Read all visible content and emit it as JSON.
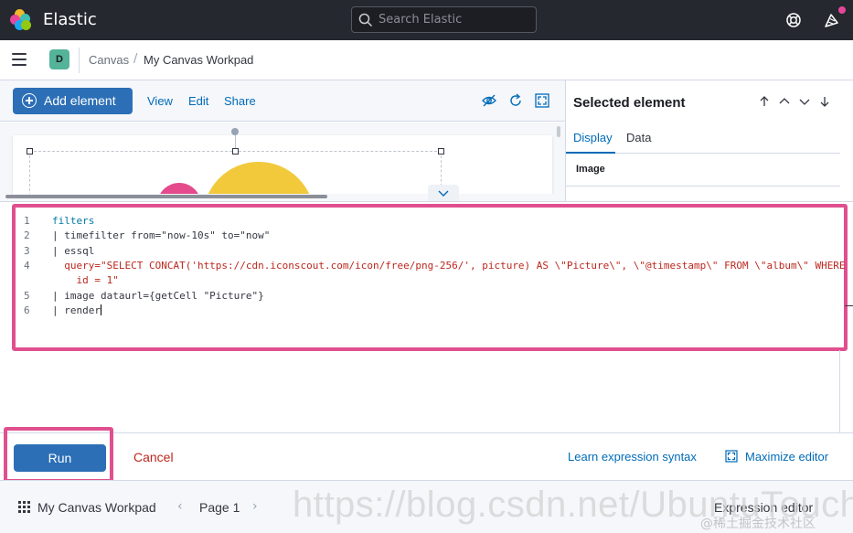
{
  "header": {
    "brand": "Elastic",
    "search_placeholder": "Search Elastic"
  },
  "breadcrumbs": {
    "space_initial": "D",
    "items": [
      "Canvas",
      "My Canvas Workpad"
    ],
    "separator": "/"
  },
  "toolbar": {
    "add_element": "Add element",
    "view": "View",
    "edit": "Edit",
    "share": "Share"
  },
  "right_panel": {
    "title": "Selected element",
    "tabs": [
      "Display",
      "Data"
    ],
    "section": "Image"
  },
  "editor": {
    "lines": [
      {
        "num": "1",
        "text": "filters"
      },
      {
        "num": "2",
        "text": "| timefilter from=\"now-10s\" to=\"now\""
      },
      {
        "num": "3",
        "text": "| essql"
      },
      {
        "num": "4",
        "text": "  query=\"SELECT CONCAT('https://cdn.iconscout.com/icon/free/png-256/', picture) AS \\\"Picture\\\", \\\"@timestamp\\\" FROM \\\"album\\\" WHERE"
      },
      {
        "num": "",
        "text": "    id = 1\""
      },
      {
        "num": "5",
        "text": "| image dataurl={getCell \"Picture\"}"
      },
      {
        "num": "6",
        "text": "| render"
      }
    ]
  },
  "actions": {
    "run": "Run",
    "cancel": "Cancel",
    "learn": "Learn expression syntax",
    "maximize": "Maximize editor"
  },
  "footer": {
    "workpad_title": "My Canvas Workpad",
    "page": "Page 1",
    "expression_editor": "Expression editor"
  },
  "watermark": {
    "url": "https://blog.csdn.net/UbuntuTouch",
    "sub": "@稀土掘金技术社区"
  },
  "colors": {
    "header_bg": "#25282f",
    "primary": "#2c6fb6",
    "link": "#006bb8",
    "danger": "#bd271e",
    "highlight_frame": "#e0508f"
  }
}
